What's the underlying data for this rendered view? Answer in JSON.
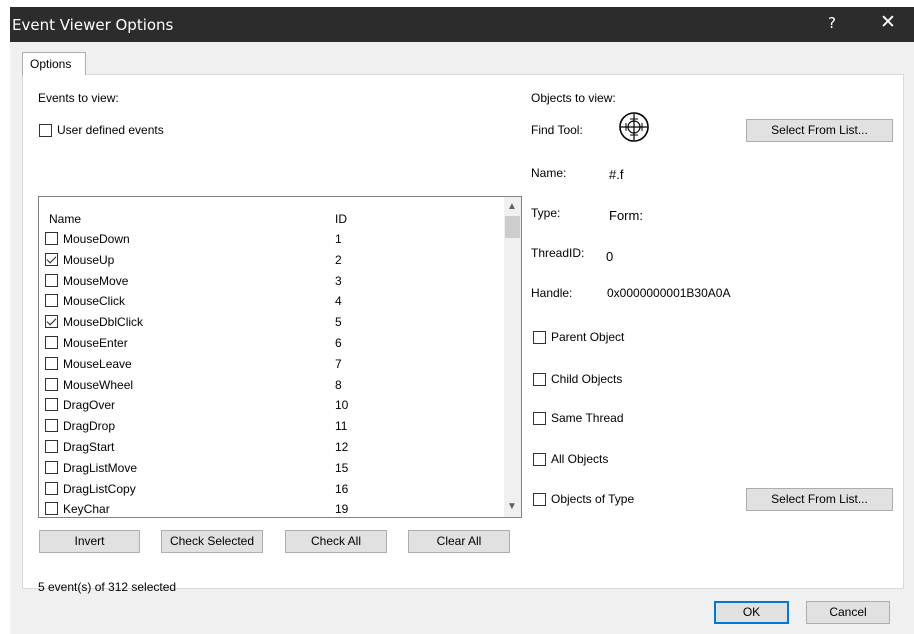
{
  "window": {
    "title": "Event Viewer Options",
    "help_label": "?",
    "close_label": "✕"
  },
  "tabs": [
    {
      "label": "Options"
    }
  ],
  "events": {
    "heading": "Events to view:",
    "user_defined_label": "User defined events",
    "user_defined_checked": false,
    "columns": {
      "name": "Name",
      "id": "ID"
    },
    "rows": [
      {
        "name": "MouseDown",
        "id": "1",
        "checked": false
      },
      {
        "name": "MouseUp",
        "id": "2",
        "checked": true
      },
      {
        "name": "MouseMove",
        "id": "3",
        "checked": false
      },
      {
        "name": "MouseClick",
        "id": "4",
        "checked": false
      },
      {
        "name": "MouseDblClick",
        "id": "5",
        "checked": true
      },
      {
        "name": "MouseEnter",
        "id": "6",
        "checked": false
      },
      {
        "name": "MouseLeave",
        "id": "7",
        "checked": false
      },
      {
        "name": "MouseWheel",
        "id": "8",
        "checked": false
      },
      {
        "name": "DragOver",
        "id": "10",
        "checked": false
      },
      {
        "name": "DragDrop",
        "id": "11",
        "checked": false
      },
      {
        "name": "DragStart",
        "id": "12",
        "checked": false
      },
      {
        "name": "DragListMove",
        "id": "15",
        "checked": false
      },
      {
        "name": "DragListCopy",
        "id": "16",
        "checked": false
      },
      {
        "name": "KeyChar",
        "id": "19",
        "checked": false
      }
    ],
    "buttons": {
      "invert": "Invert",
      "check_selected": "Check Selected",
      "check_all": "Check All",
      "clear_all": "Clear All"
    },
    "status": "5 event(s) of 312 selected"
  },
  "objects": {
    "heading": "Objects to view:",
    "find_tool_label": "Find Tool:",
    "select_from_list": "Select From List...",
    "name_label": "Name:",
    "name_value": "#.f",
    "type_label": "Type:",
    "type_value": "Form:",
    "threadid_label": "ThreadID:",
    "threadid_value": "0",
    "handle_label": "Handle:",
    "handle_value": "0x0000000001B30A0A",
    "parent_objects": "Parent Object",
    "child_objects": "Child Objects",
    "same_thread": "Same Thread",
    "all_objects": "All Objects",
    "objects_of_type": "Objects of Type",
    "select_from_list_2": "Select From List..."
  },
  "footer": {
    "ok": "OK",
    "cancel": "Cancel"
  }
}
